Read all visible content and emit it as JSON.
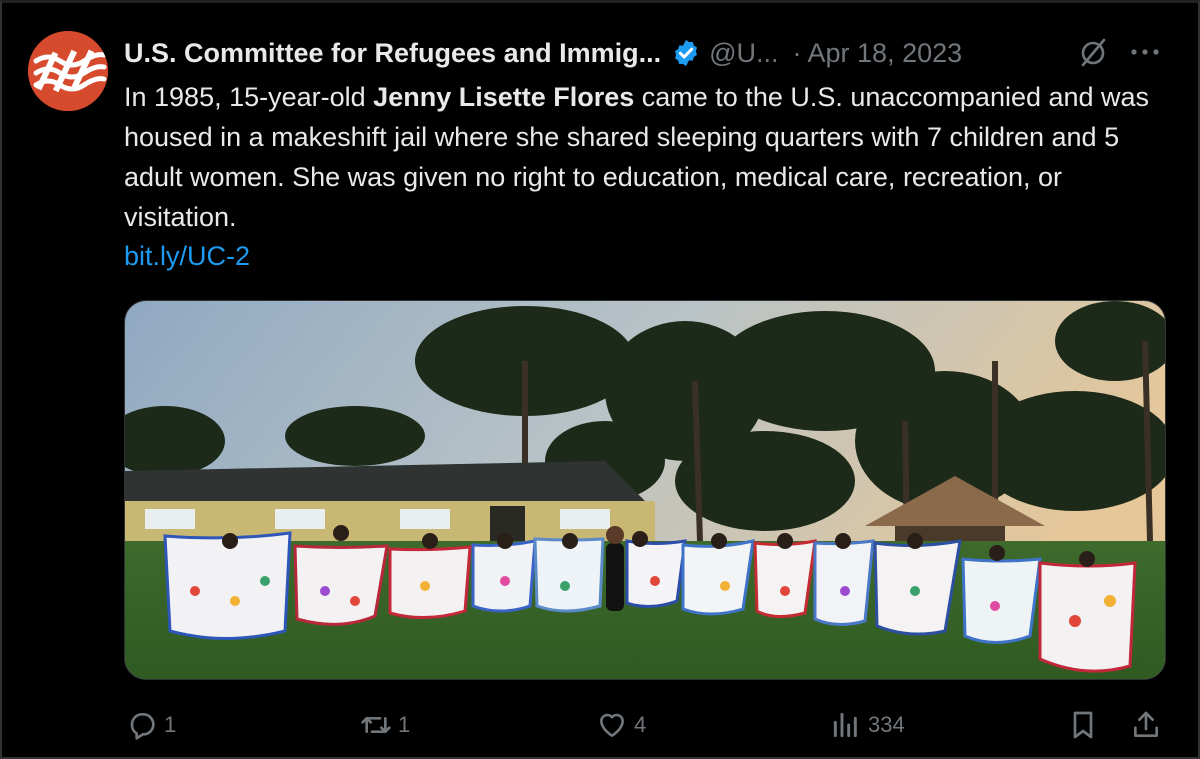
{
  "tweet": {
    "author_name": "U.S. Committee for Refugees and Immig...",
    "handle": "@U...",
    "separator": "·",
    "date": "Apr 18, 2023",
    "text_before": "In 1985, 15-year-old ",
    "text_bold": "Jenny Lisette Flores",
    "text_after": " came to the U.S. unaccompanied and was housed in a makeshift jail where she shared sleeping quarters with 7 children and 5 adult women. She was given no right to education, medical care, recreation, or visitation.",
    "link": "bit.ly/UC-2"
  },
  "icons": {
    "avatar": "uscri-logo",
    "verified": "verified-badge-icon",
    "grok": "grok-icon",
    "more": "more-icon",
    "reply": "reply-icon",
    "retweet": "retweet-icon",
    "like": "heart-icon",
    "views": "views-icon",
    "bookmark": "bookmark-icon",
    "share": "share-icon"
  },
  "actions": {
    "replies": "1",
    "retweets": "1",
    "likes": "4",
    "views": "334"
  },
  "colors": {
    "background": "#000000",
    "text": "#e7e9ea",
    "muted": "#71767b",
    "link": "#1d9bf0",
    "verified": "#1d9bf0",
    "avatar": "#d64a2e"
  }
}
